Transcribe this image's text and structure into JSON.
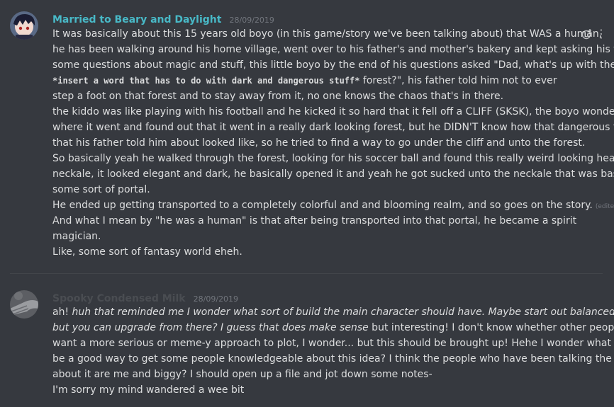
{
  "messages": [
    {
      "author": "Married to Beary and Daylight",
      "author_color": "#48b9c7",
      "timestamp": "28/09/2019",
      "avatar_icon": "anime-character-avatar-icon",
      "lines": {
        "l1": "It was basically about this 15 years old boyo (in this game/story we've been talking about) that WAS  a human,",
        "l2": "he has been walking around his home village, went over to his father's and mother's bakery and kept asking his father",
        "l3": "some questions about magic and stuff, this little boyo by the end of his questions asked \"Dad, what's up with the",
        "l4_code": "*insert a word that has to do with dark and dangerous stuff*",
        "l4_rest": " forest?\", his father told him not to ever",
        "l5": "step a foot on that forest and to stay away from it, no one knows the chaos that's in there.",
        "l6": "the kiddo was like playing with his football and he kicked it so hard that it fell off a CLIFF (SKSK), the boyo wondered",
        "l7": "where it went and found out that it went in a really dark looking forest, but he DIDN'T know how that dangerous forest",
        "l8": "that his father told him about looked like, so he tried to find a way to go under the cliff and unto the forest.",
        "l9": "So basically yeah he walked through the forest, looking for his soccer ball and found this really weird looking heart",
        "l10": "neckale, it looked elegant and dark, he basically opened it and yeah he got sucked unto the neckale that was basically",
        "l11": "some sort of portal.",
        "l12": "He ended up getting transported to a completely colorful and and blooming realm, and so goes on the story.",
        "l12_edited": "(edited)",
        "l13": "And what I mean by \"he was a human\" is that after being transported into that portal, he became a spirit",
        "l14": "magician.",
        "l15": "Like, some sort of fantasy world eheh."
      }
    },
    {
      "author": "Spooky Condensed Milk",
      "author_color": "#4a4d52",
      "timestamp": "28/09/2019",
      "avatar_icon": "hand-avatar-icon",
      "lines": {
        "l1_plain": "ah! ",
        "l1_italic": "huh that reminded me I wonder what sort of build the main character should have. Maybe start out balanced",
        "l2_italic": "but you can upgrade from there? I guess that does make sense",
        "l2_plain": " but interesting! I don't know whether other people",
        "l3": "want a more serious or meme-y approach to plot, I wonder... but this should be brought up! Hehe I wonder what would",
        "l4": "be a good way to get some people knowledgeable about this idea? I think the people who have been talking the most",
        "l5": "about it are me and biggy? I should open up a file and jot down some notes-",
        "l6": "I'm sorry my mind wandered a wee bit"
      }
    }
  ],
  "message_actions": {
    "add_reaction_icon": "add-reaction-icon",
    "more_icon": "more-options-icon",
    "more_glyph": "⋮"
  }
}
